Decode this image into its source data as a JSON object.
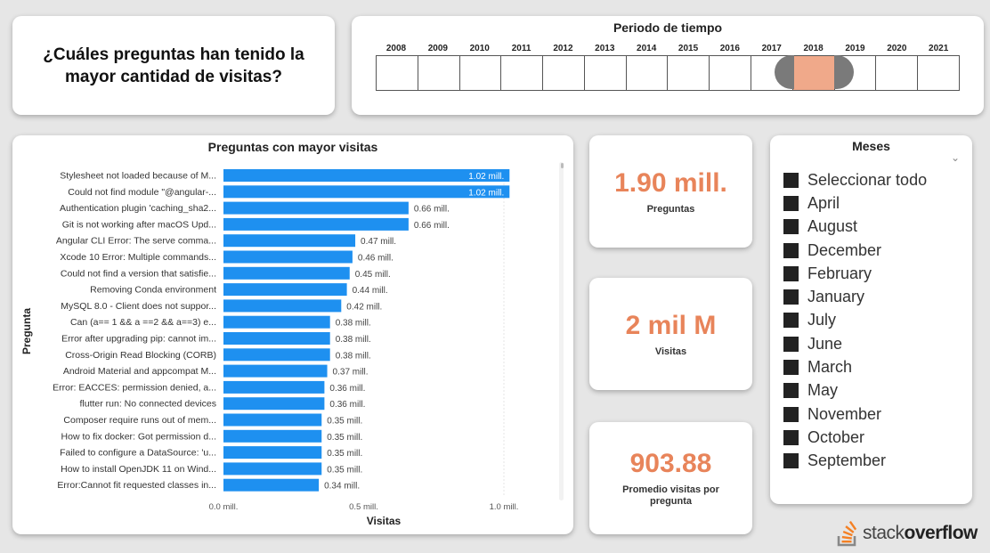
{
  "title": "¿Cuáles preguntas han tenido la mayor cantidad de visitas?",
  "period": {
    "title": "Periodo de tiempo",
    "years": [
      "2008",
      "2009",
      "2010",
      "2011",
      "2012",
      "2013",
      "2014",
      "2015",
      "2016",
      "2017",
      "2018",
      "2019",
      "2020",
      "2021"
    ],
    "selected": "2018"
  },
  "chart_data": {
    "type": "bar",
    "orientation": "horizontal",
    "title": "Preguntas con mayor visitas",
    "xlabel": "Visitas",
    "ylabel": "Pregunta",
    "xlim": [
      0,
      1.0
    ],
    "xticks": [
      "0.0 mill.",
      "0.5 mill.",
      "1.0 mill."
    ],
    "categories": [
      "Stylesheet not loaded because of M...",
      "Could not find module \"@angular-...",
      "Authentication plugin 'caching_sha2...",
      "Git is not working after macOS Upd...",
      "Angular CLI Error: The serve comma...",
      "Xcode 10 Error: Multiple commands...",
      "Could not find a version that satisfie...",
      "Removing Conda environment",
      "MySQL 8.0 - Client does not suppor...",
      "Can (a== 1 && a ==2 && a==3) e...",
      "Error after upgrading pip: cannot im...",
      "Cross-Origin Read Blocking (CORB)",
      "Android Material and appcompat M...",
      "Error: EACCES: permission denied, a...",
      "flutter run: No connected devices",
      "Composer require runs out of mem...",
      "How to fix docker: Got permission d...",
      "Failed to configure a DataSource: 'u...",
      "How to install OpenJDK 11 on Wind...",
      "Error:Cannot fit requested classes in..."
    ],
    "values": [
      1.02,
      1.02,
      0.66,
      0.66,
      0.47,
      0.46,
      0.45,
      0.44,
      0.42,
      0.38,
      0.38,
      0.38,
      0.37,
      0.36,
      0.36,
      0.35,
      0.35,
      0.35,
      0.35,
      0.34
    ],
    "labels": [
      "1.02 mill.",
      "1.02 mill.",
      "0.66 mill.",
      "0.66 mill.",
      "0.47 mill.",
      "0.46 mill.",
      "0.45 mill.",
      "0.44 mill.",
      "0.42 mill.",
      "0.38 mill.",
      "0.38 mill.",
      "0.38 mill.",
      "0.37 mill.",
      "0.36 mill.",
      "0.36 mill.",
      "0.35 mill.",
      "0.35 mill.",
      "0.35 mill.",
      "0.35 mill.",
      "0.34 mill."
    ],
    "bar_color": "#1e90f0",
    "grid": false
  },
  "kpis": [
    {
      "value": "1.90 mill.",
      "label": "Preguntas"
    },
    {
      "value": "2 mil M",
      "label": "Visitas"
    },
    {
      "value": "903.88",
      "label": "Promedio visitas por pregunta"
    }
  ],
  "months": {
    "title": "Meses",
    "items": [
      "Seleccionar todo",
      "April",
      "August",
      "December",
      "February",
      "January",
      "July",
      "June",
      "March",
      "May",
      "November",
      "October",
      "September"
    ]
  },
  "logo": {
    "part1": "stack",
    "part2": "overflow"
  },
  "colors": {
    "accent": "#e8845a",
    "bar": "#1e90f0",
    "selected_year": "#f0a98a"
  }
}
